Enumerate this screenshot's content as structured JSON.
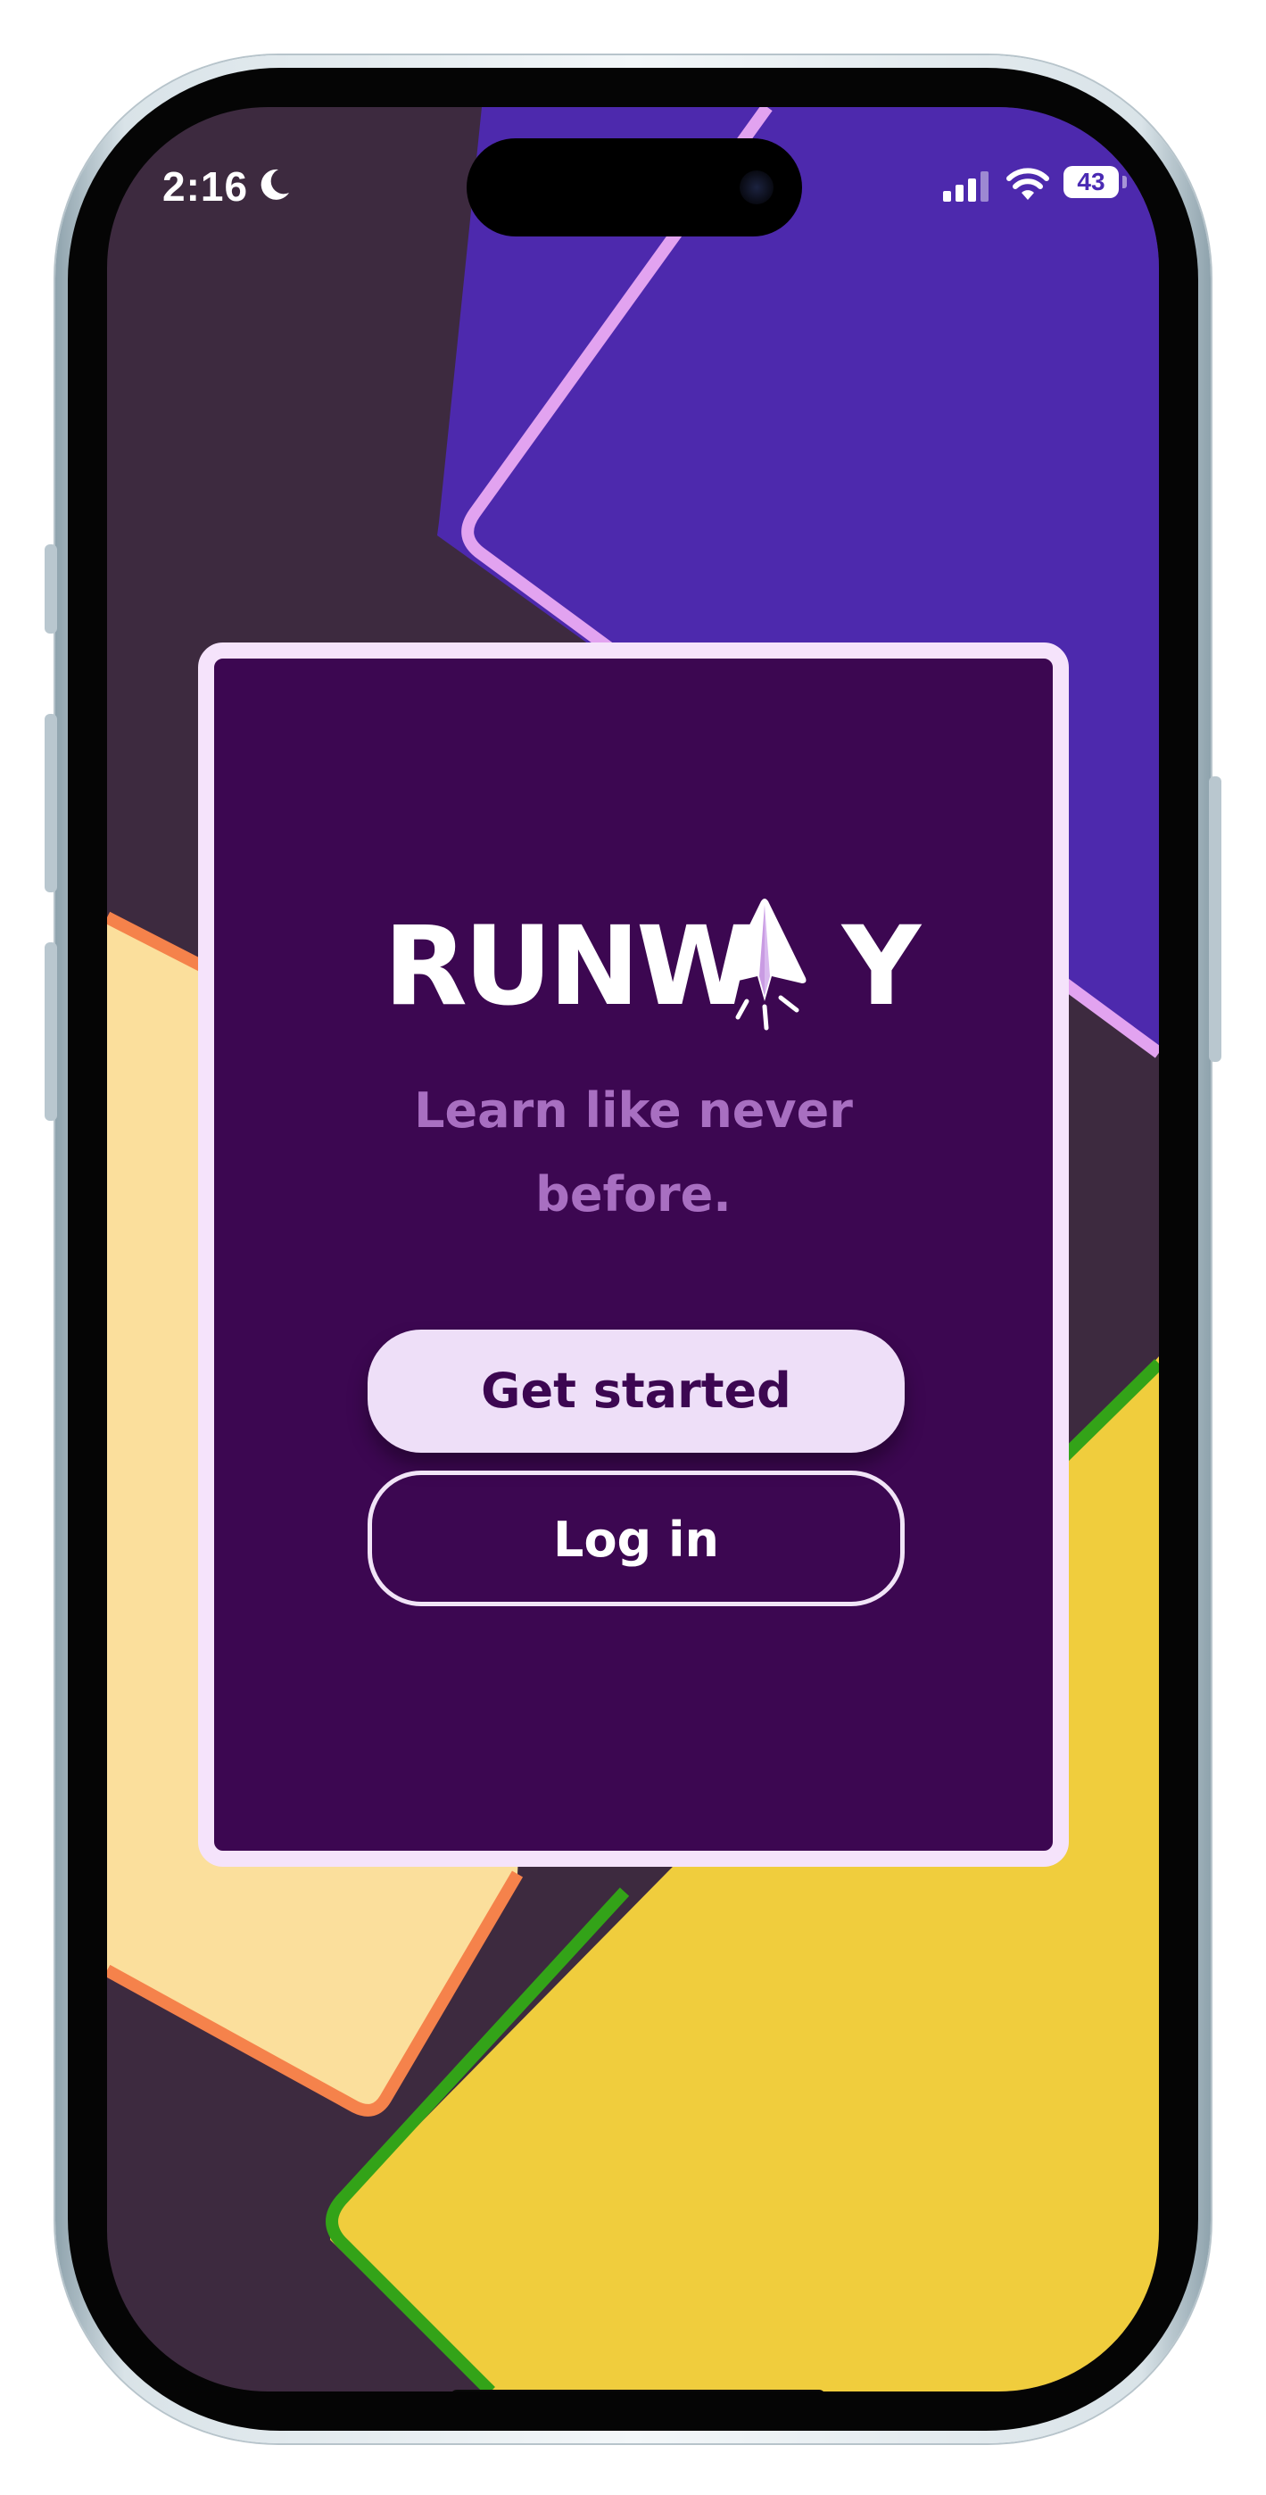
{
  "app": {
    "name": "Runway"
  },
  "status_bar": {
    "time": "2:16",
    "battery_level": "43",
    "icons": [
      "moon-icon",
      "signal-icon",
      "wifi-icon",
      "battery-icon"
    ]
  },
  "welcome_card": {
    "logo_text": "RUNWAY",
    "logo_prefix": "RUNW",
    "logo_suffix": "Y",
    "tagline_line1": "Learn like never",
    "tagline_line2": "before.",
    "get_started_label": "Get started",
    "login_label": "Log in"
  },
  "colors": {
    "background": "#3d2a3f",
    "card_fill": "#3c0751",
    "card_border": "#f5e3fb",
    "tagline": "#a86fc1",
    "primary_button": "#eedff8",
    "shape_purple": "#4d29ad",
    "shape_purple_border": "#e2a3f0",
    "shape_peach": "#fbdf9c",
    "shape_peach_border": "#f5824b",
    "shape_yellow": "#f0cd3d",
    "shape_yellow_border": "#33a318"
  }
}
